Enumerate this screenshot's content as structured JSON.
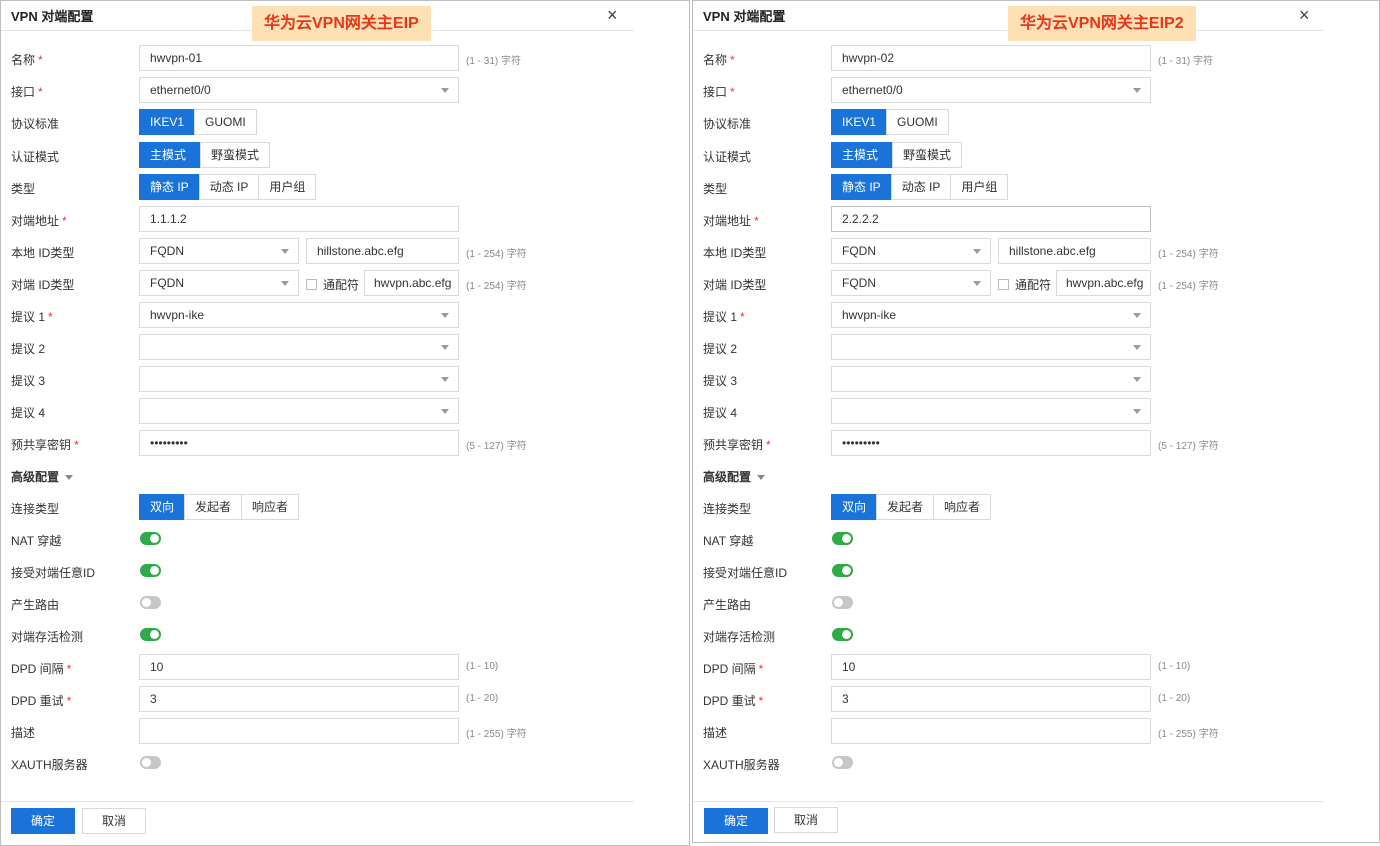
{
  "dialogs": [
    {
      "title": "VPN 对端配置",
      "annotation": "华为云VPN网关主EIP",
      "close_icon": "×",
      "name": {
        "label": "名称",
        "value": "hwvpn-01",
        "hint": "(1 - 31) 字符"
      },
      "interface": {
        "label": "接口",
        "value": "ethernet0/0"
      },
      "protocol": {
        "label": "协议标准",
        "options": [
          "IKEV1",
          "GUOMI"
        ]
      },
      "auth_mode": {
        "label": "认证模式",
        "options": [
          "主模式",
          "野蛮模式"
        ]
      },
      "type": {
        "label": "类型",
        "options": [
          "静态 IP",
          "动态 IP",
          "用户组"
        ]
      },
      "peer_address": {
        "label": "对端地址",
        "value": "1.1.1.2"
      },
      "local_id": {
        "label": "本地 ID类型",
        "type": "FQDN",
        "value": "hillstone.abc.efg",
        "hint": "(1 - 254) 字符"
      },
      "peer_id": {
        "label": "对端 ID类型",
        "type": "FQDN",
        "wildcard": "通配符",
        "value": "hwvpn.abc.efg",
        "hint": "(1 - 254) 字符"
      },
      "proposal1": {
        "label": "提议 1",
        "value": "hwvpn-ike"
      },
      "proposal2": {
        "label": "提议 2",
        "value": ""
      },
      "proposal3": {
        "label": "提议 3",
        "value": ""
      },
      "proposal4": {
        "label": "提议 4",
        "value": ""
      },
      "psk": {
        "label": "预共享密钥",
        "value": "•••••••••",
        "hint": "(5 - 127) 字符"
      },
      "advanced": {
        "label": "高级配置"
      },
      "conn_type": {
        "label": "连接类型",
        "options": [
          "双向",
          "发起者",
          "响应者"
        ]
      },
      "nat": {
        "label": "NAT 穿越"
      },
      "accept_any": {
        "label": "接受对端任意ID"
      },
      "gen_route": {
        "label": "产生路由"
      },
      "dpd": {
        "label": "对端存活检测"
      },
      "dpd_interval": {
        "label": "DPD 间隔",
        "value": "10",
        "hint": "(1 - 10)"
      },
      "dpd_retry": {
        "label": "DPD 重试",
        "value": "3",
        "hint": "(1 - 20)"
      },
      "desc": {
        "label": "描述",
        "value": "",
        "hint": "(1 - 255) 字符"
      },
      "xauth": {
        "label": "XAUTH服务器"
      },
      "ok": "确定",
      "cancel": "取消"
    },
    {
      "title": "VPN 对端配置",
      "annotation": "华为云VPN网关主EIP2",
      "close_icon": "×",
      "name": {
        "label": "名称",
        "value": "hwvpn-02",
        "hint": "(1 - 31) 字符"
      },
      "interface": {
        "label": "接口",
        "value": "ethernet0/0"
      },
      "protocol": {
        "label": "协议标准",
        "options": [
          "IKEV1",
          "GUOMI"
        ]
      },
      "auth_mode": {
        "label": "认证模式",
        "options": [
          "主模式",
          "野蛮模式"
        ]
      },
      "type": {
        "label": "类型",
        "options": [
          "静态 IP",
          "动态 IP",
          "用户组"
        ]
      },
      "peer_address": {
        "label": "对端地址",
        "value": "2.2.2.2"
      },
      "local_id": {
        "label": "本地 ID类型",
        "type": "FQDN",
        "value": "hillstone.abc.efg",
        "hint": "(1 - 254) 字符"
      },
      "peer_id": {
        "label": "对端 ID类型",
        "type": "FQDN",
        "wildcard": "通配符",
        "value": "hwvpn.abc.efg",
        "hint": "(1 - 254) 字符"
      },
      "proposal1": {
        "label": "提议 1",
        "value": "hwvpn-ike"
      },
      "proposal2": {
        "label": "提议 2",
        "value": ""
      },
      "proposal3": {
        "label": "提议 3",
        "value": ""
      },
      "proposal4": {
        "label": "提议 4",
        "value": ""
      },
      "psk": {
        "label": "预共享密钥",
        "value": "•••••••••",
        "hint": "(5 - 127) 字符"
      },
      "advanced": {
        "label": "高级配置"
      },
      "conn_type": {
        "label": "连接类型",
        "options": [
          "双向",
          "发起者",
          "响应者"
        ]
      },
      "nat": {
        "label": "NAT 穿越"
      },
      "accept_any": {
        "label": "接受对端任意ID"
      },
      "gen_route": {
        "label": "产生路由"
      },
      "dpd": {
        "label": "对端存活检测"
      },
      "dpd_interval": {
        "label": "DPD 间隔",
        "value": "10",
        "hint": "(1 - 10)"
      },
      "dpd_retry": {
        "label": "DPD 重试",
        "value": "3",
        "hint": "(1 - 20)"
      },
      "desc": {
        "label": "描述",
        "value": "",
        "hint": "(1 - 255) 字符"
      },
      "xauth": {
        "label": "XAUTH服务器"
      },
      "ok": "确定",
      "cancel": "取消"
    }
  ]
}
